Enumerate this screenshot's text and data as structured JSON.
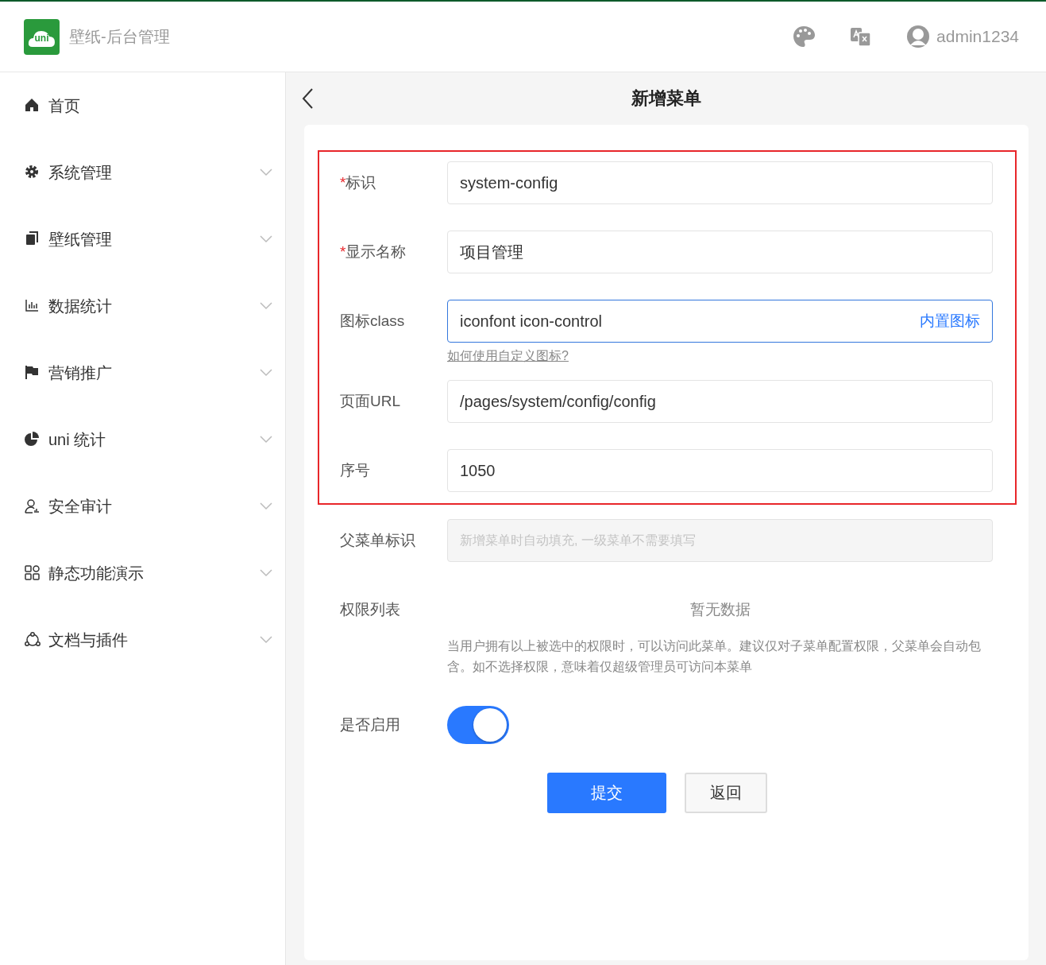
{
  "header": {
    "logo_text": "uni",
    "title": "壁纸-后台管理",
    "user": "admin1234"
  },
  "sidebar": {
    "items": [
      {
        "label": "首页",
        "expandable": false
      },
      {
        "label": "系统管理",
        "expandable": true
      },
      {
        "label": "壁纸管理",
        "expandable": true
      },
      {
        "label": "数据统计",
        "expandable": true
      },
      {
        "label": "营销推广",
        "expandable": true
      },
      {
        "label": "uni 统计",
        "expandable": true
      },
      {
        "label": "安全审计",
        "expandable": true
      },
      {
        "label": "静态功能演示",
        "expandable": true
      },
      {
        "label": "文档与插件",
        "expandable": true
      }
    ]
  },
  "page": {
    "title": "新增菜单",
    "highlight_box": {
      "fields": [
        {
          "kind": "input",
          "label": "标识",
          "required_mark": "*",
          "value": "system-config"
        },
        {
          "kind": "input",
          "label": "显示名称",
          "required_mark": "*",
          "value": "项目管理"
        },
        {
          "kind": "input",
          "label": "图标class",
          "value": "iconfont icon-control",
          "focused": true,
          "action": "内置图标",
          "hint": "如何使用自定义图标?"
        },
        {
          "kind": "input",
          "label": "页面URL",
          "value": "/pages/system/config/config"
        },
        {
          "kind": "input",
          "label": "序号",
          "value": "1050"
        }
      ]
    },
    "fields": [
      {
        "kind": "input",
        "label": "父菜单标识",
        "placeholder": "新增菜单时自动填充, 一级菜单不需要填写",
        "disabled": true
      },
      {
        "kind": "list",
        "label": "权限列表",
        "empty_text": "暂无数据",
        "note": "当用户拥有以上被选中的权限时，可以访问此菜单。建议仅对子菜单配置权限，父菜单会自动包含。如不选择权限，意味着仅超级管理员可访问本菜单"
      },
      {
        "kind": "switch",
        "label": "是否启用",
        "on": true
      }
    ],
    "buttons": [
      {
        "label": "提交",
        "kind": "primary"
      },
      {
        "label": "返回",
        "kind": "default"
      }
    ]
  }
}
